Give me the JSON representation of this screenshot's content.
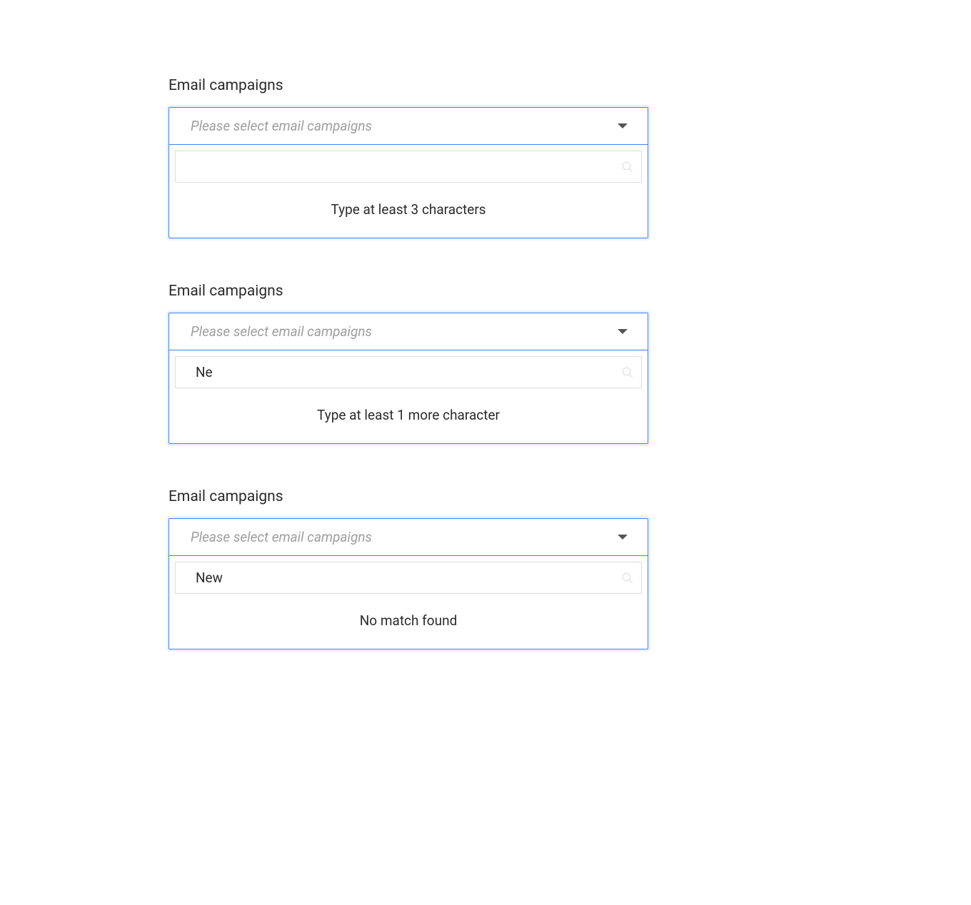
{
  "examples": [
    {
      "label": "Email campaigns",
      "placeholder": "Please select email campaigns",
      "search_value": "",
      "hint": "Type at least 3 characters"
    },
    {
      "label": "Email campaigns",
      "placeholder": "Please select email campaigns",
      "search_value": "Ne",
      "hint": "Type at least 1 more character"
    },
    {
      "label": "Email campaigns",
      "placeholder": "Please select email campaigns",
      "search_value": "New",
      "hint": "No match found"
    }
  ]
}
